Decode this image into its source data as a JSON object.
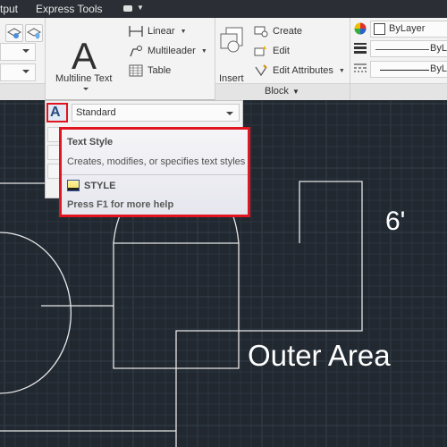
{
  "tabs": {
    "output": "tput",
    "express_tools": "Express Tools"
  },
  "ribbon": {
    "annotation": {
      "multiline_text": "Multiline Text",
      "linear": "Linear",
      "multileader": "Multileader",
      "table": "Table"
    },
    "block": {
      "insert": "Insert",
      "create": "Create",
      "edit": "Edit",
      "edit_attributes": "Edit Attributes",
      "panel_title": "Block"
    },
    "properties": {
      "color": "ByLayer",
      "lineweight": "ByLa",
      "linetype": "ByLa"
    }
  },
  "text_style_panel": {
    "current_style": "Standard"
  },
  "tooltip": {
    "title": "Text Style",
    "description": "Creates, modifies, or specifies text styles",
    "command": "STYLE",
    "help": "Press F1 for more help"
  },
  "drawing": {
    "dimension_label": "6'",
    "area_label": "Outer Area",
    "line_color": "#e8e8e8",
    "grid_color": "#2c3440"
  },
  "colors": {
    "highlight": "#e0151f",
    "canvas_bg": "#212830",
    "ribbon_bg": "#f3f3f3"
  }
}
